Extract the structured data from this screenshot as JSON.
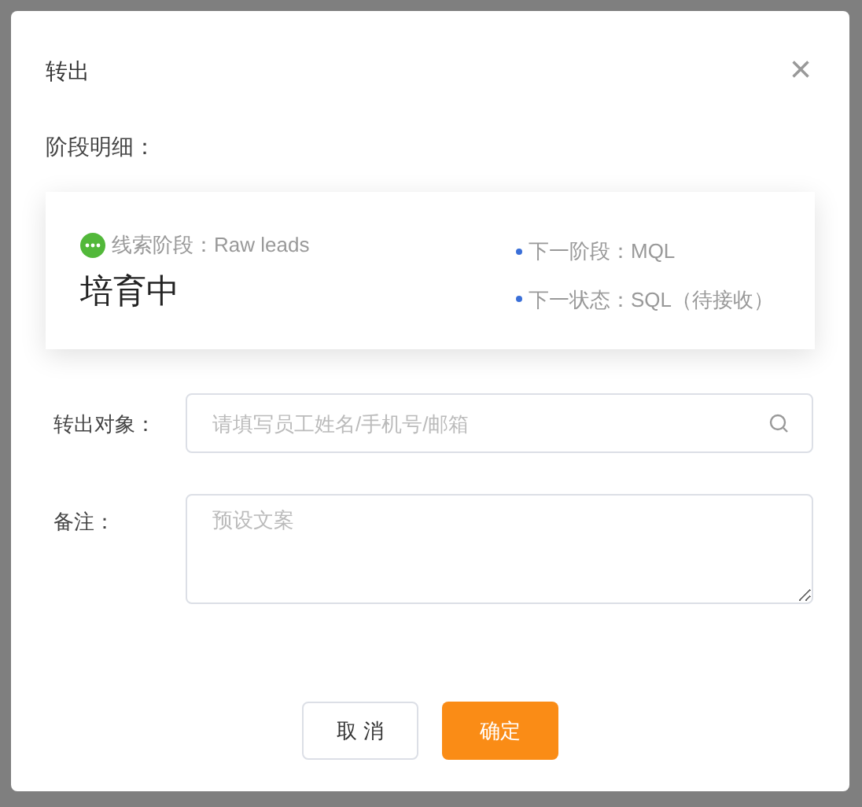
{
  "dialog": {
    "title": "转出",
    "close": "×"
  },
  "section_label": "阶段明细：",
  "stage_card": {
    "stage_label": "线索阶段：Raw leads",
    "status": "培育中",
    "next": [
      "下一阶段：MQL",
      "下一状态：SQL（待接收）"
    ]
  },
  "form": [
    {
      "kind": "search",
      "label": "转出对象：",
      "placeholder": "请填写员工姓名/手机号/邮箱"
    },
    {
      "kind": "textarea",
      "label": "备注：",
      "placeholder": "预设文案"
    }
  ],
  "buttons": [
    {
      "kind": "secondary",
      "label": "取 消"
    },
    {
      "kind": "primary",
      "label": "确定"
    }
  ]
}
